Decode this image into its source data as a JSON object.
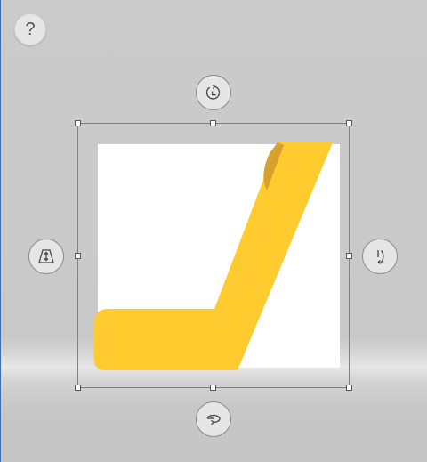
{
  "help": {
    "label": "?"
  },
  "colors": {
    "shape_fill": "#ffcb2f",
    "canvas": "#ffffff",
    "handle_border": "#555555"
  },
  "shape": {
    "name": "chair-shape"
  },
  "controls": {
    "rotate_icon": "rotate-cw-icon",
    "perspective_icon": "perspective-trapezoid-icon",
    "tilt_icon": "tilt-rotate-icon",
    "spin_icon": "spin-horizontal-icon"
  }
}
